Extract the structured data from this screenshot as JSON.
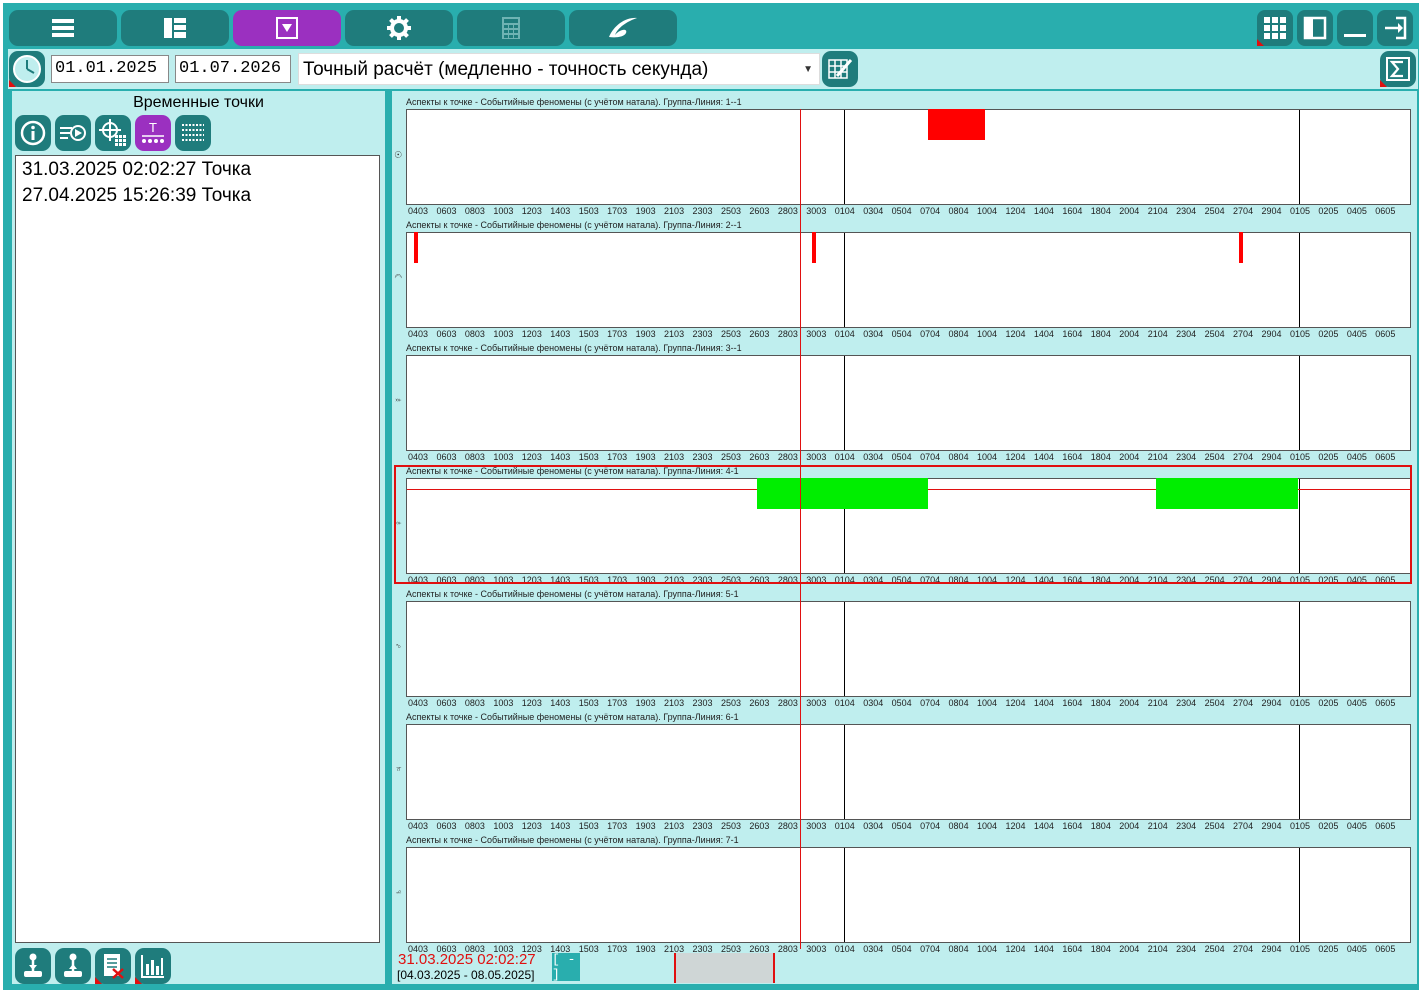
{
  "top_tabs": [
    {
      "icon": "list-icon",
      "active": false
    },
    {
      "icon": "layout-icon",
      "active": false
    },
    {
      "icon": "dropdown-box-icon",
      "active": true
    },
    {
      "icon": "gear-icon",
      "active": false
    },
    {
      "icon": "calculator-icon",
      "active": false
    },
    {
      "icon": "logo-swirl-icon",
      "active": false
    }
  ],
  "window_buttons": [
    "grid-icon",
    "panel-icon",
    "minimize-icon",
    "exit-icon"
  ],
  "toolbar": {
    "date_from": "01.01.2025",
    "date_to": "01.07.2026",
    "calc_mode": "Точный расчёт (медленно - точность секунда)"
  },
  "left_panel": {
    "title": "Временные точки",
    "tool_icons": [
      "info-icon",
      "export-icon",
      "crosshair-grid-icon",
      "time-points-icon",
      "list-lines-icon"
    ],
    "items": [
      "31.03.2025 02:02:27 Точка",
      "27.04.2025 15:26:39 Точка"
    ],
    "bottom_icons": [
      "joystick-down-icon",
      "joystick-up-icon",
      "delete-list-icon",
      "chart-bars-icon"
    ]
  },
  "charts": {
    "ticks": [
      "0403",
      "0603",
      "0803",
      "1003",
      "1203",
      "1403",
      "1503",
      "1703",
      "1903",
      "2103",
      "2303",
      "2503",
      "2603",
      "2803",
      "3003",
      "0104",
      "0304",
      "0504",
      "0704",
      "0804",
      "1004",
      "1204",
      "1404",
      "1604",
      "1804",
      "2004",
      "2104",
      "2304",
      "2504",
      "2704",
      "2904",
      "0105",
      "0205",
      "0405",
      "0605"
    ],
    "panels": [
      {
        "title": "Аспекты к точке - Событийные феномены (с учётом натала). Группа-Линия: 1--1",
        "symbol": "☉"
      },
      {
        "title": "Аспекты к точке - Событийные феномены (с учётом натала). Группа-Линия: 2--1",
        "symbol": "☽"
      },
      {
        "title": "Аспекты к точке - Событийные феномены (с учётом натала). Группа-Линия: 3--1",
        "symbol": "☿"
      },
      {
        "title": "Аспекты к точке - Событийные феномены (с учётом натала). Группа-Линия: 4-1",
        "symbol": "♀"
      },
      {
        "title": "Аспекты к точке - Событийные феномены (с учётом натала). Группа-Линия: 5-1",
        "symbol": "♂"
      },
      {
        "title": "Аспекты к точке - Событийные феномены (с учётом натала). Группа-Линия: 6-1",
        "symbol": "♃"
      },
      {
        "title": "Аспекты к точке - Событийные феномены (с учётом натала). Группа-Линия: 7-1",
        "symbol": "♄"
      }
    ],
    "events": [
      {
        "panel": 0,
        "start": "0704",
        "end": "1004",
        "color": "#ff0000"
      },
      {
        "panel": 1,
        "start": "0403",
        "end": "0403",
        "color": "#ff0000"
      },
      {
        "panel": 1,
        "start": "3003",
        "end": "3003",
        "color": "#ff0000"
      },
      {
        "panel": 1,
        "start": "2704",
        "end": "2704",
        "color": "#ff0000"
      },
      {
        "panel": 3,
        "start": "2603",
        "end": "0704",
        "color": "#00ee00"
      },
      {
        "panel": 3,
        "start": "2104",
        "end": "0105",
        "color": "#00ee00"
      }
    ],
    "black_lines": [
      "0104",
      "0105"
    ],
    "red_line": "3003",
    "selected_panel": 3
  },
  "status": {
    "current": "31.03.2025 02:02:27",
    "range": "[04.03.2025 - 08.05.2025]",
    "zoom_label": "[ - ]"
  },
  "colors": {
    "accent": "#29aeae",
    "dark": "#1f7c7c",
    "active": "#9b30c0",
    "marker": "#e01010"
  }
}
